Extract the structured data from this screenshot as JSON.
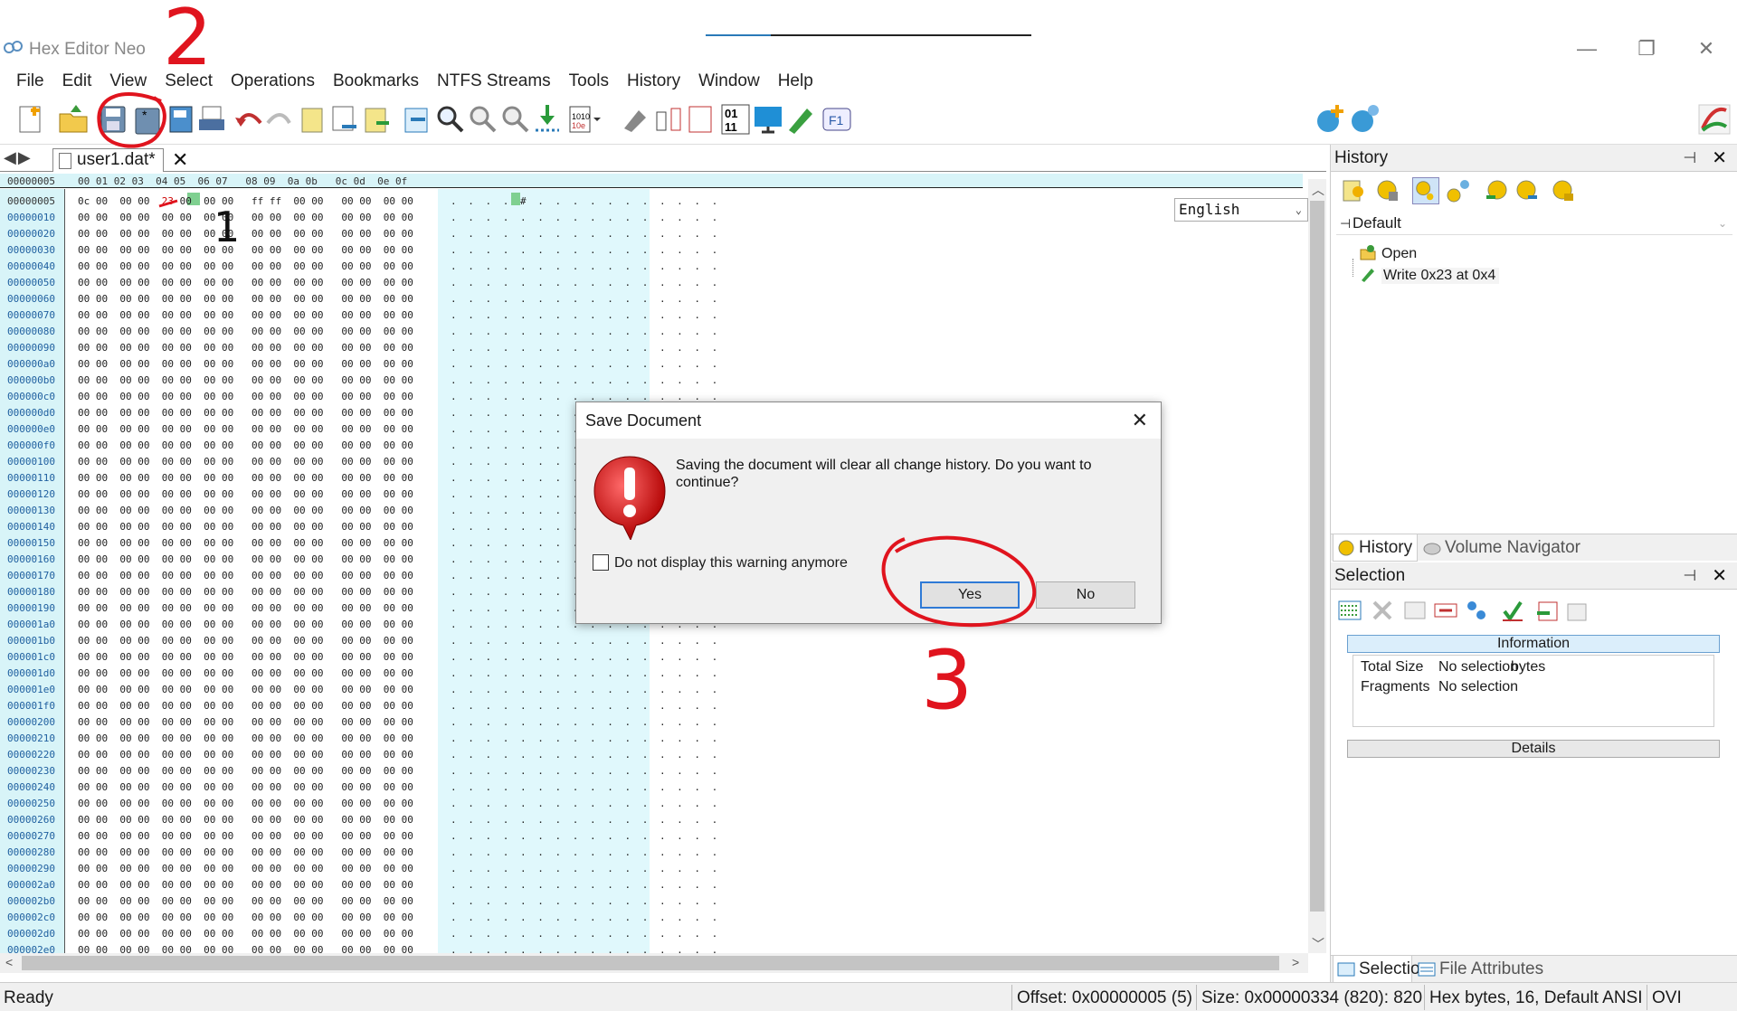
{
  "window": {
    "title": "Hex Editor Neo",
    "minimize": "—",
    "restore": "❐",
    "close": "✕"
  },
  "menu": [
    "File",
    "Edit",
    "View",
    "Select",
    "Operations",
    "Bookmarks",
    "NTFS Streams",
    "Tools",
    "History",
    "Window",
    "Help"
  ],
  "toolbar": {
    "language": "English"
  },
  "editor": {
    "nav_arrows": "◀▶",
    "tab_label": "user1.dat*",
    "tab_close": "✕",
    "header_addr": "00000005",
    "header_cols": "00 01 02 03  04 05  06 07   08 09  0a 0b   0c 0d  0e 0f",
    "first_row": {
      "addr": "00000005",
      "hex_a": "0c 00  00 00  ",
      "hex_b": "23",
      "hex_c": " 00  00 00   ff ff  00 00   00 00  00 00",
      "ascii": ". . . . # . . . . . . . . . . ."
    },
    "zero_row_hex": "00 00  00 00  00 00  00 00   00 00  00 00   00 00  00 00",
    "zero_row_ascii": ". . . . . . . . . . . . . . . .",
    "rows": [
      "00000010",
      "00000020",
      "00000030",
      "00000040",
      "00000050",
      "00000060",
      "00000070",
      "00000080",
      "00000090",
      "000000a0",
      "000000b0",
      "000000c0",
      "000000d0",
      "000000e0",
      "000000f0",
      "00000100",
      "00000110",
      "00000120",
      "00000130",
      "00000140",
      "00000150",
      "00000160",
      "00000170",
      "00000180",
      "00000190",
      "000001a0",
      "000001b0",
      "000001c0",
      "000001d0",
      "000001e0",
      "000001f0",
      "00000200",
      "00000210",
      "00000220",
      "00000230",
      "00000240",
      "00000250",
      "00000260",
      "00000270",
      "00000280",
      "00000290",
      "000002a0",
      "000002b0",
      "000002c0",
      "000002d0",
      "000002e0"
    ]
  },
  "status": {
    "ready": "Ready",
    "offset": "Offset: 0x00000005 (5)",
    "size": "Size: 0x00000334 (820): 820",
    "mode": "Hex bytes, 16, Default ANSI",
    "ovr": "OVI"
  },
  "history_panel": {
    "title": "History",
    "pin": "⊣",
    "close": "✕",
    "group": "Default",
    "items": [
      "Open",
      "Write 0x23 at 0x4"
    ],
    "tabs": [
      "History",
      "Volume Navigator"
    ]
  },
  "selection_panel": {
    "title": "Selection",
    "information": "Information",
    "rows": [
      {
        "label": "Total Size",
        "value": "No selection",
        "unit": "bytes"
      },
      {
        "label": "Fragments",
        "value": "No selection",
        "unit": ""
      }
    ],
    "details": "Details",
    "tabs": [
      "Selection",
      "File Attributes"
    ]
  },
  "dialog": {
    "title": "Save Document",
    "close": "✕",
    "message": "Saving the document will clear all change history. Do you want to continue?",
    "checkbox_label": "Do not display this warning anymore",
    "yes": "Yes",
    "no": "No"
  },
  "annotations": [
    "1",
    "2",
    "3"
  ],
  "colors": {
    "annotation_red": "#e0141e",
    "hex_bg": "#d8f4f8",
    "ascii_bg": "#e0f8fc",
    "highlight": "#7fd090",
    "accent": "#2f7ad6"
  }
}
